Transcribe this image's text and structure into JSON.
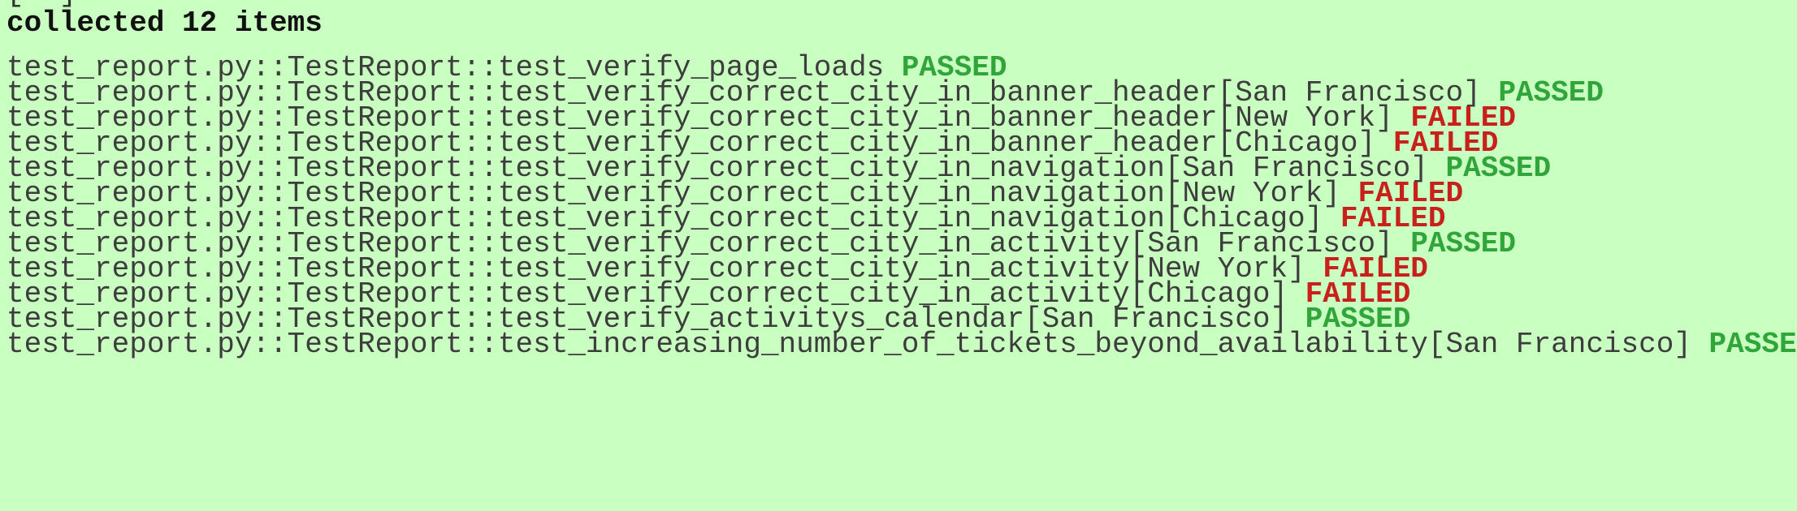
{
  "terminal": {
    "partial_top": "[  ]",
    "header": "collected 12 items",
    "colors": {
      "background": "#c9ffc0",
      "text": "#3d3d3d",
      "passed": "#2fa53a",
      "failed": "#c8201b"
    },
    "results": [
      {
        "test": "test_report.py::TestReport::test_verify_page_loads",
        "status": "PASSED"
      },
      {
        "test": "test_report.py::TestReport::test_verify_correct_city_in_banner_header[San Francisco]",
        "status": "PASSED"
      },
      {
        "test": "test_report.py::TestReport::test_verify_correct_city_in_banner_header[New York]",
        "status": "FAILED"
      },
      {
        "test": "test_report.py::TestReport::test_verify_correct_city_in_banner_header[Chicago]",
        "status": "FAILED"
      },
      {
        "test": "test_report.py::TestReport::test_verify_correct_city_in_navigation[San Francisco]",
        "status": "PASSED"
      },
      {
        "test": "test_report.py::TestReport::test_verify_correct_city_in_navigation[New York]",
        "status": "FAILED"
      },
      {
        "test": "test_report.py::TestReport::test_verify_correct_city_in_navigation[Chicago]",
        "status": "FAILED"
      },
      {
        "test": "test_report.py::TestReport::test_verify_correct_city_in_activity[San Francisco]",
        "status": "PASSED"
      },
      {
        "test": "test_report.py::TestReport::test_verify_correct_city_in_activity[New York]",
        "status": "FAILED"
      },
      {
        "test": "test_report.py::TestReport::test_verify_correct_city_in_activity[Chicago]",
        "status": "FAILED"
      },
      {
        "test": "test_report.py::TestReport::test_verify_activitys_calendar[San Francisco]",
        "status": "PASSED"
      },
      {
        "test": "test_report.py::TestReport::test_increasing_number_of_tickets_beyond_availability[San Francisco]",
        "status": "PASSED"
      }
    ]
  }
}
